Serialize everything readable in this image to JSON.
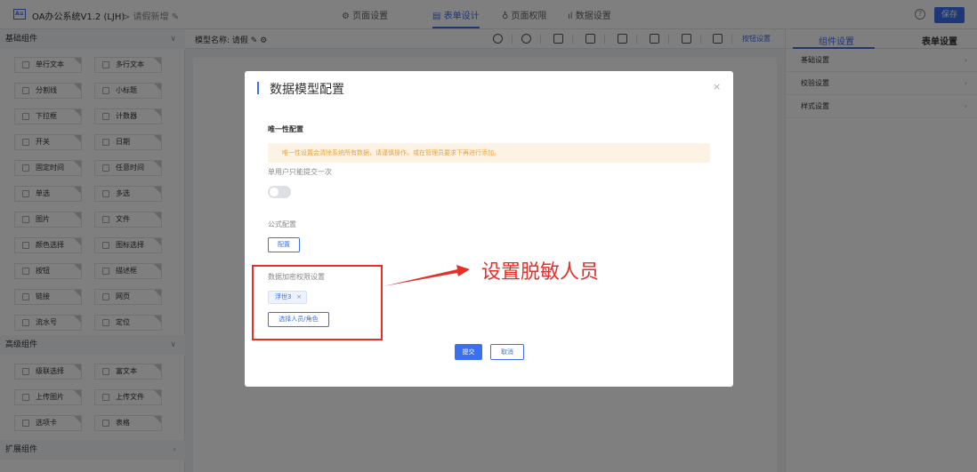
{
  "topbar": {
    "logo_text": "A≡",
    "app_title": "OA办公系统V1.2 (LJH)",
    "breadcrumb": "> 请假新增 ✎",
    "tabs": [
      "⚙ 页面设置",
      "▤ 表单设计",
      "♁ 页面权限",
      "ıl 数据设置"
    ],
    "active_tab": "▤ 表单设计",
    "help_icon": "?",
    "save_label": "保存",
    "accent_color": "#3a6ff0"
  },
  "left_panel": {
    "basic_title": "基础组件",
    "advanced_title": "高级组件",
    "extend_title": "扩展组件",
    "basic_components": [
      "单行文本",
      "多行文本",
      "分割线",
      "小标题",
      "下拉框",
      "计数器",
      "开关",
      "日期",
      "固定时间",
      "任意时间",
      "单选",
      "多选",
      "图片",
      "文件",
      "颜色选择",
      "图标选择",
      "按钮",
      "描述框",
      "链接",
      "网页",
      "流水号",
      "定位"
    ],
    "advanced_components": [
      "级联选择",
      "富文本",
      "上传图片",
      "上传文件",
      "选项卡",
      "表格"
    ]
  },
  "canvas": {
    "model_name": "模型名称: 请假 ✎ ⚙",
    "button_settings": "按钮设置"
  },
  "right_panel": {
    "tabs": [
      "组件设置",
      "表单设置"
    ],
    "items": [
      "基础设置",
      "校验设置",
      "样式设置"
    ]
  },
  "modal": {
    "title": "数据模型配置",
    "close_icon": "×",
    "unique_title": "唯一性配置",
    "warning": "唯一性设置会清除系统所有数据，请谨慎操作。或在管理员要求下再进行添加。",
    "single_submit_label": "单用户只能提交一次",
    "single_submit_on": false,
    "formula_title": "公式配置",
    "formula_button": "配置",
    "encryption_title": "数据加密权限设置",
    "selected_tag": "浮世3",
    "tag_close": "×",
    "select_button": "选择人员/角色",
    "submit_label": "提交",
    "cancel_label": "取消"
  },
  "annotation": {
    "text": "设置脱敏人员",
    "color": "#e5302a"
  }
}
